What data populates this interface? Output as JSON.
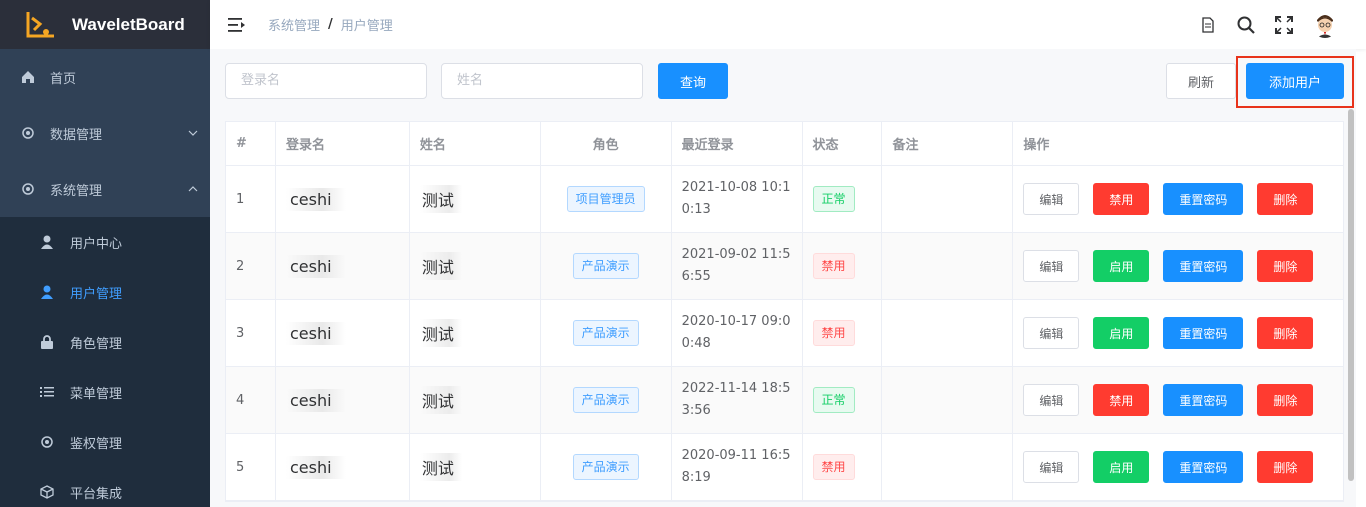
{
  "brand": {
    "name": "WaveletBoard"
  },
  "sidebar": {
    "items": [
      {
        "label": "首页",
        "icon": "home-icon"
      },
      {
        "label": "数据管理",
        "icon": "gear-icon",
        "expanded": false
      },
      {
        "label": "系统管理",
        "icon": "gear-icon",
        "expanded": true
      }
    ],
    "sub_items": [
      {
        "label": "用户中心",
        "icon": "user-icon",
        "active": false
      },
      {
        "label": "用户管理",
        "icon": "user-icon",
        "active": true
      },
      {
        "label": "角色管理",
        "icon": "lock-icon",
        "active": false
      },
      {
        "label": "菜单管理",
        "icon": "list-icon",
        "active": false
      },
      {
        "label": "鉴权管理",
        "icon": "gear-icon",
        "active": false
      },
      {
        "label": "平台集成",
        "icon": "cube-icon",
        "active": false
      }
    ]
  },
  "header": {
    "breadcrumb": [
      "系统管理",
      "/",
      "用户管理"
    ]
  },
  "toolbar": {
    "login_placeholder": "登录名",
    "name_placeholder": "姓名",
    "query_label": "查询",
    "refresh_label": "刷新",
    "add_user_label": "添加用户"
  },
  "table": {
    "headers": [
      "#",
      "登录名",
      "姓名",
      "角色",
      "最近登录",
      "状态",
      "备注",
      "操作"
    ],
    "rows": [
      {
        "index": "1",
        "login": "ceshi",
        "name": "测试",
        "role": "项目管理员",
        "last_login": "2021-10-08 10:10:13",
        "status": "正常",
        "status_type": "green",
        "toggle_label": "禁用",
        "toggle_type": "danger",
        "note": ""
      },
      {
        "index": "2",
        "login": "ceshi",
        "name": "测试",
        "role": "产品演示",
        "last_login": "2021-09-02 11:56:55",
        "status": "禁用",
        "status_type": "red",
        "toggle_label": "启用",
        "toggle_type": "success",
        "note": ""
      },
      {
        "index": "3",
        "login": "ceshi",
        "name": "测试",
        "role": "产品演示",
        "last_login": "2020-10-17 09:00:48",
        "status": "禁用",
        "status_type": "red",
        "toggle_label": "启用",
        "toggle_type": "success",
        "note": ""
      },
      {
        "index": "4",
        "login": "ceshi",
        "name": "测试",
        "role": "产品演示",
        "last_login": "2022-11-14 18:53:56",
        "status": "正常",
        "status_type": "green",
        "toggle_label": "禁用",
        "toggle_type": "danger",
        "note": ""
      },
      {
        "index": "5",
        "login": "ceshi",
        "name": "测试",
        "role": "产品演示",
        "last_login": "2020-09-11 16:58:19",
        "status": "禁用",
        "status_type": "red",
        "toggle_label": "启用",
        "toggle_type": "success",
        "note": ""
      }
    ],
    "op_edit": "编辑",
    "op_reset": "重置密码",
    "op_delete": "删除"
  },
  "colors": {
    "sidebar_bg": "#304156",
    "brand_bg": "#2b2f3a",
    "primary": "#1890ff",
    "danger": "#ff3b30",
    "success": "#13ce66",
    "highlight": "#e8331b"
  }
}
